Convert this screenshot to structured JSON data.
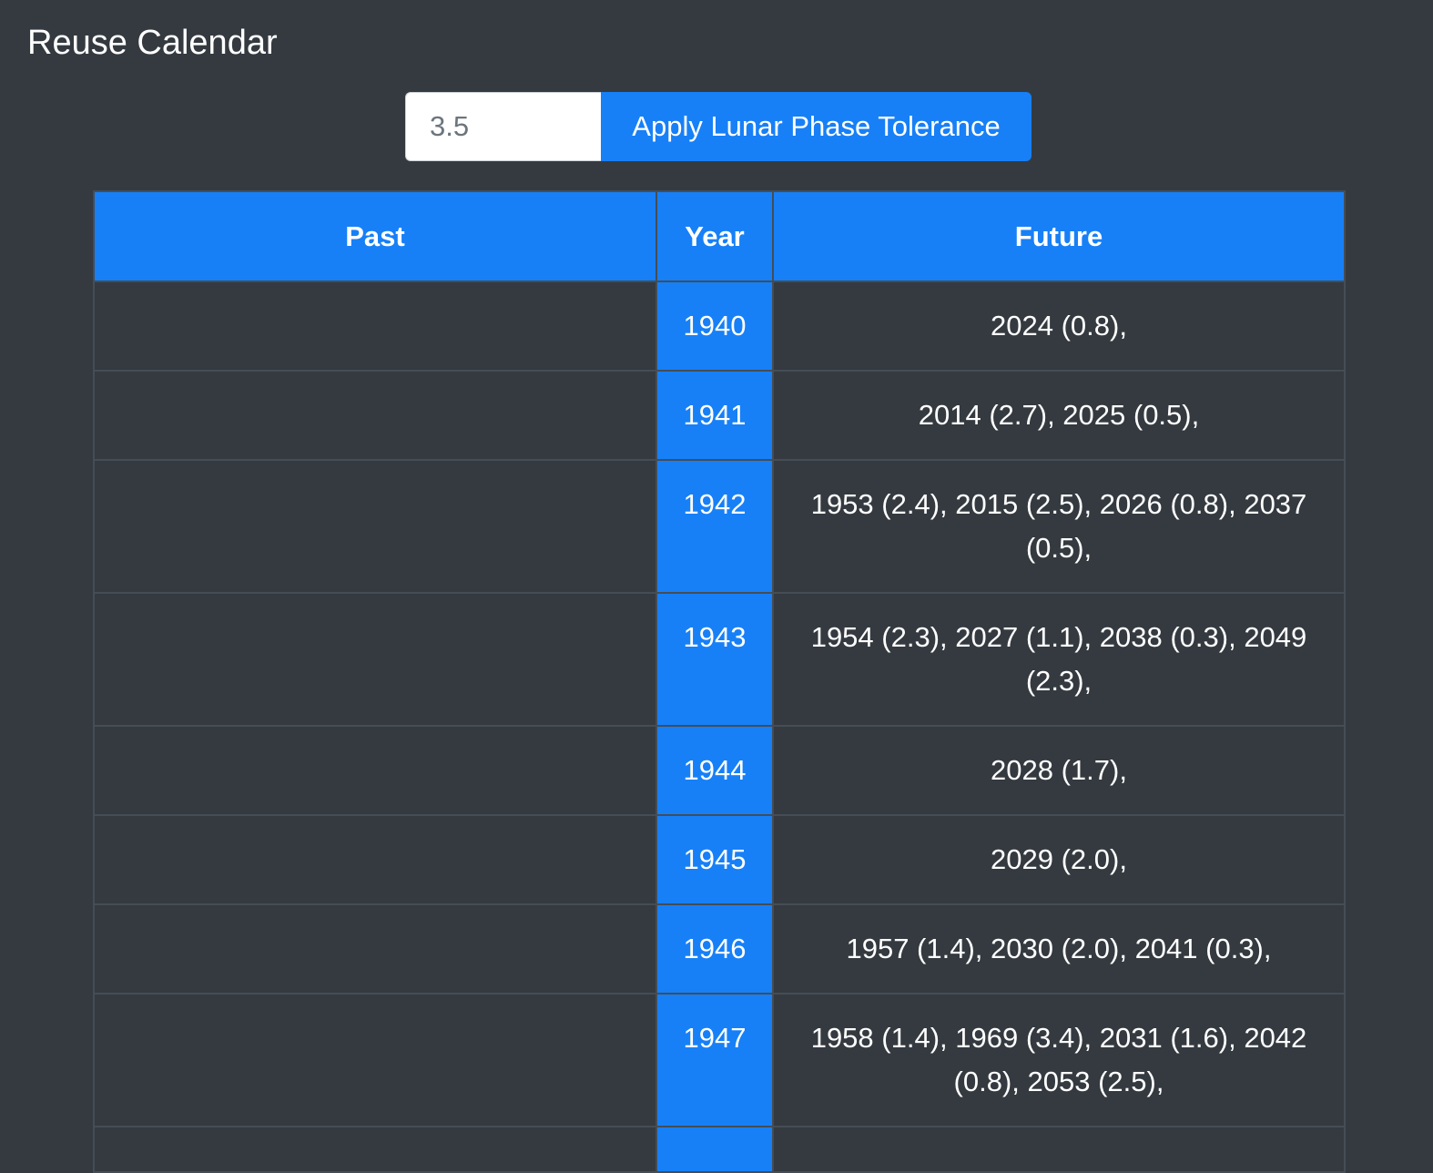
{
  "page": {
    "title": "Reuse Calendar"
  },
  "controls": {
    "tolerance_value": "3.5",
    "apply_button_label": "Apply Lunar Phase Tolerance"
  },
  "table": {
    "headers": {
      "past": "Past",
      "year": "Year",
      "future": "Future"
    },
    "rows": [
      {
        "past": "",
        "year": "1940",
        "future": "2024 (0.8),"
      },
      {
        "past": "",
        "year": "1941",
        "future": "2014 (2.7), 2025 (0.5),"
      },
      {
        "past": "",
        "year": "1942",
        "future": "1953 (2.4), 2015 (2.5), 2026 (0.8), 2037 (0.5),"
      },
      {
        "past": "",
        "year": "1943",
        "future": "1954 (2.3), 2027 (1.1), 2038 (0.3), 2049 (2.3),"
      },
      {
        "past": "",
        "year": "1944",
        "future": "2028 (1.7),"
      },
      {
        "past": "",
        "year": "1945",
        "future": "2029 (2.0),"
      },
      {
        "past": "",
        "year": "1946",
        "future": "1957 (1.4), 2030 (2.0), 2041 (0.3),"
      },
      {
        "past": "",
        "year": "1947",
        "future": "1958 (1.4), 1969 (3.4), 2031 (1.6), 2042 (0.8), 2053 (2.5),"
      },
      {
        "past": "",
        "year": "",
        "future": ""
      }
    ]
  },
  "colors": {
    "background": "#343a40",
    "accent": "#1780f7",
    "border": "#454d55"
  }
}
